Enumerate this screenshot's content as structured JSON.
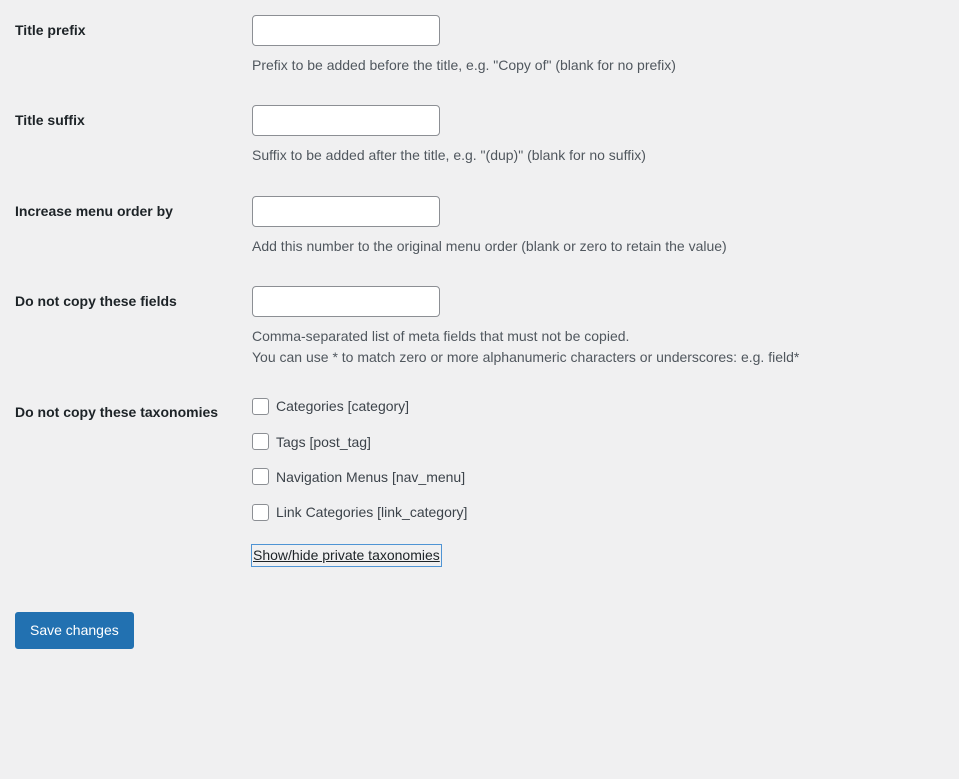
{
  "form": {
    "rows": [
      {
        "label": "Title prefix",
        "input_value": "",
        "input_placeholder": "",
        "descriptions": [
          "Prefix to be added before the title, e.g. \"Copy of\" (blank for no prefix)"
        ]
      },
      {
        "label": "Title suffix",
        "input_value": "",
        "input_placeholder": "",
        "descriptions": [
          "Suffix to be added after the title, e.g. \"(dup)\" (blank for no suffix)"
        ]
      },
      {
        "label": "Increase menu order by",
        "input_value": "",
        "input_placeholder": "",
        "descriptions": [
          "Add this number to the original menu order (blank or zero to retain the value)"
        ]
      },
      {
        "label": "Do not copy these fields",
        "input_value": "",
        "input_placeholder": "",
        "descriptions": [
          "Comma-separated list of meta fields that must not be copied.",
          "You can use * to match zero or more alphanumeric characters or underscores: e.g. field*"
        ]
      }
    ],
    "taxonomies_row": {
      "label": "Do not copy these taxonomies",
      "checkboxes": [
        {
          "label": "Categories [category]",
          "checked": false
        },
        {
          "label": "Tags [post_tag]",
          "checked": false
        },
        {
          "label": "Navigation Menus [nav_menu]",
          "checked": false
        },
        {
          "label": "Link Categories [link_category]",
          "checked": false
        }
      ],
      "toggle_link": "Show/hide private taxonomies"
    },
    "submit": {
      "save_label": "Save changes"
    }
  },
  "colors": {
    "page_background": "#f0f0f1",
    "accent_blue": "#2271b1",
    "focus_outline": "#4f94d4",
    "label_text": "#1d2327",
    "description_text": "#50575e",
    "input_border": "#8c8f94"
  }
}
